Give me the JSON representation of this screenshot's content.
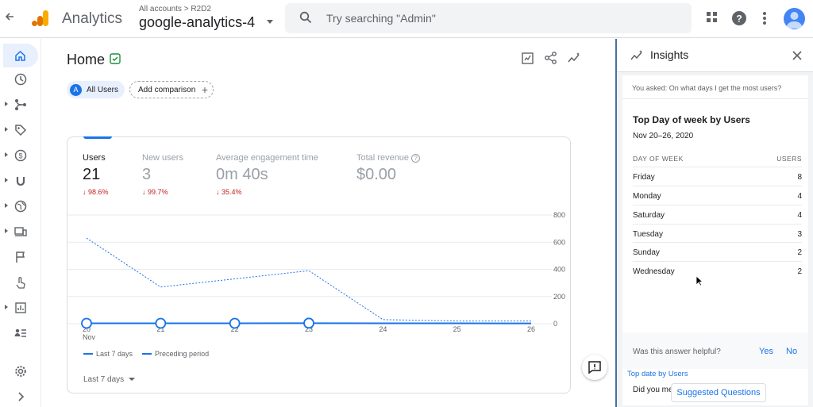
{
  "topbar": {
    "app_name": "Analytics",
    "breadcrumb": "All accounts > R2D2",
    "property": "google-analytics-4",
    "search_placeholder": "Try searching \"Admin\""
  },
  "nav": {
    "items": [
      "home",
      "reports",
      "explore",
      "advertising",
      "monetization",
      "acquisition",
      "demographics",
      "tech",
      "events",
      "engagement",
      "library",
      "audience"
    ],
    "bottom": [
      "settings",
      "expand"
    ]
  },
  "main": {
    "title": "Home",
    "comparison": {
      "chip_letter": "A",
      "chip_label": "All Users",
      "add_label": "Add comparison"
    },
    "metrics": [
      {
        "label": "Users",
        "value": "21",
        "delta": "98.6%"
      },
      {
        "label": "New users",
        "value": "3",
        "delta": "99.7%"
      },
      {
        "label": "Average engagement time",
        "value": "0m 40s",
        "delta": "35.4%"
      },
      {
        "label": "Total revenue",
        "value": "$0.00",
        "delta": ""
      }
    ],
    "range_label": "Last 7 days"
  },
  "chart_data": {
    "type": "line",
    "categories": [
      "20 Nov",
      "21",
      "22",
      "23",
      "24",
      "25",
      "26"
    ],
    "x_tick_labels": [
      "20",
      "21",
      "22",
      "23",
      "24",
      "25",
      "26"
    ],
    "x_sub_label": "Nov",
    "y_ticks": [
      0,
      200,
      400,
      600,
      800
    ],
    "ylim": [
      0,
      800
    ],
    "series": [
      {
        "name": "Last 7 days",
        "style": "solid",
        "values": [
          3,
          3,
          3,
          4,
          3,
          3,
          2
        ]
      },
      {
        "name": "Preceding period",
        "style": "dashed",
        "values": [
          630,
          270,
          330,
          390,
          30,
          20,
          20
        ]
      }
    ],
    "color": "#1a73e8",
    "grid": true
  },
  "insights": {
    "title": "Insights",
    "asked": "You asked: On what days I get the most users?",
    "answer_title": "Top Day of week by Users",
    "answer_date": "Nov 20–26, 2020",
    "table_headers": [
      "DAY OF WEEK",
      "USERS"
    ],
    "rows": [
      {
        "day": "Friday",
        "users": "8"
      },
      {
        "day": "Monday",
        "users": "4"
      },
      {
        "day": "Saturday",
        "users": "4"
      },
      {
        "day": "Tuesday",
        "users": "3"
      },
      {
        "day": "Sunday",
        "users": "2"
      },
      {
        "day": "Wednesday",
        "users": "2"
      }
    ],
    "helpful_question": "Was this answer helpful?",
    "yes": "Yes",
    "no": "No",
    "did_you_mean": "Did you mean:",
    "did_you_mean_link": "Top date by Users",
    "suggested": "Suggested Questions"
  },
  "colors": {
    "accent": "#1a73e8",
    "negative": "#c5221f",
    "insights_border": "#4a6fa5"
  }
}
